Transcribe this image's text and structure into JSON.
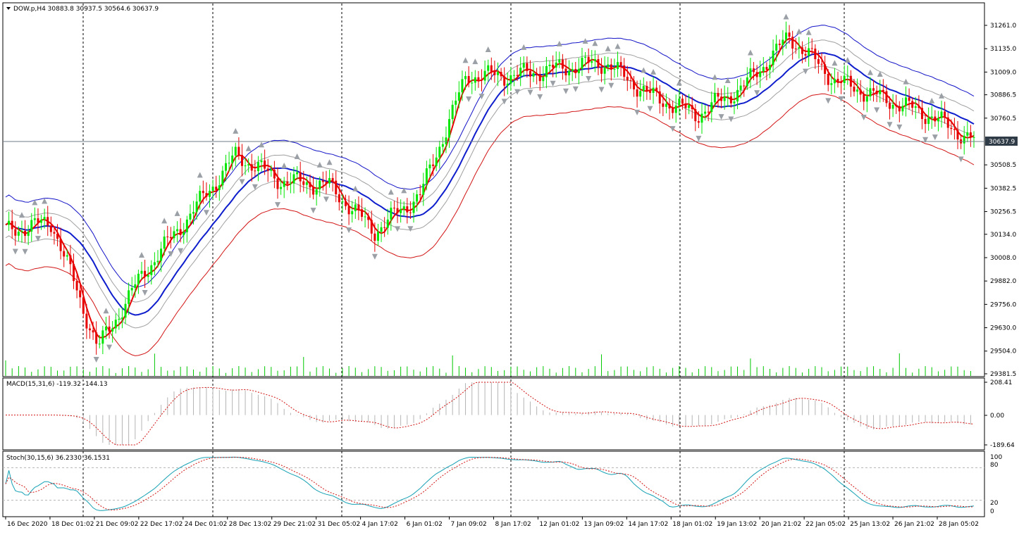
{
  "colors": {
    "bull": "#00e600",
    "bear": "#e60000",
    "bandOuter": "#1414c8",
    "bandMid": "#0f1ecc",
    "bandInner": "#a0a0a0",
    "bandLower": "#d21414",
    "ma": "#e60000",
    "macdSignal": "#d21414",
    "stochMain": "#14a0b4",
    "stochSignal": "#d21414",
    "volume": "#00c800",
    "priceLine": "#6e7b87",
    "priceLabelBg": "#2f3b46"
  },
  "main_panel": {
    "title": "DOW.p,H4  30883.8 30937.5 30564.6 30637.9",
    "current_price_label": "30637.9",
    "price_ticks": [
      "31261.0",
      "31135.0",
      "31009.0",
      "30886.5",
      "30760.5",
      "30508.5",
      "30382.5",
      "30256.5",
      "30134.0",
      "30008.0",
      "29882.0",
      "29756.0",
      "29630.0",
      "29504.0",
      "29381.5"
    ]
  },
  "macd_panel": {
    "title": "MACD(15,31,6) -119.32 -144.13",
    "ticks": [
      "208.41",
      "0.00",
      "-189.64"
    ]
  },
  "stoch_panel": {
    "title": "Stoch(30,15,6) 36.2330 36.1531",
    "ticks": [
      "100",
      "80",
      "20",
      "0"
    ]
  },
  "time_axis": [
    "16 Dec 2020",
    "18 Dec 01:02",
    "21 Dec 09:02",
    "22 Dec 17:02",
    "24 Dec 01:02",
    "28 Dec 13:02",
    "29 Dec 21:02",
    "31 Dec 05:02",
    "4 Jan 17:02",
    "6 Jan 01:02",
    "7 Jan 09:02",
    "8 Jan 17:02",
    "12 Jan 01:02",
    "13 Jan 09:02",
    "14 Jan 17:02",
    "18 Jan 01:02",
    "19 Jan 13:02",
    "20 Jan 21:02",
    "22 Jan 05:02",
    "25 Jan 13:02",
    "26 Jan 21:02",
    "28 Jan 05:02"
  ],
  "chart_data": {
    "type": "candlestick",
    "symbol": "DOW.p",
    "timeframe": "H4",
    "ohlc_last": {
      "open": 30883.8,
      "high": 30937.5,
      "low": 30564.6,
      "close": 30637.9
    },
    "y_range": [
      29381.5,
      31261.0
    ],
    "close_path": [
      [
        "16 Dec 2020",
        30150
      ],
      [
        "18 Dec 01:02",
        30200
      ],
      [
        "21 Dec 09:02",
        29520
      ],
      [
        "22 Dec 17:02",
        29930
      ],
      [
        "24 Dec 01:02",
        30240
      ],
      [
        "28 Dec 13:02",
        30560
      ],
      [
        "29 Dec 21:02",
        30420
      ],
      [
        "31 Dec 05:02",
        30400
      ],
      [
        "4 Jan 17:02",
        30150
      ],
      [
        "6 Jan 01:02",
        30350
      ],
      [
        "7 Jan 09:02",
        30990
      ],
      [
        "8 Jan 17:02",
        30990
      ],
      [
        "12 Jan 01:02",
        31030
      ],
      [
        "13 Jan 09:02",
        31060
      ],
      [
        "14 Jan 17:02",
        30880
      ],
      [
        "18 Jan 01:02",
        30780
      ],
      [
        "19 Jan 13:02",
        30930
      ],
      [
        "20 Jan 21:02",
        31200
      ],
      [
        "22 Jan 05:02",
        30960
      ],
      [
        "25 Jan 13:02",
        30870
      ],
      [
        "26 Jan 21:02",
        30780
      ],
      [
        "28 Jan 05:02",
        30637.9
      ]
    ],
    "macd": {
      "main": -119.32,
      "signal": -144.13,
      "range": [
        -189.64,
        208.41
      ]
    },
    "stochastic": {
      "main": 36.233,
      "signal": 36.1531,
      "levels": [
        20,
        80
      ]
    }
  }
}
